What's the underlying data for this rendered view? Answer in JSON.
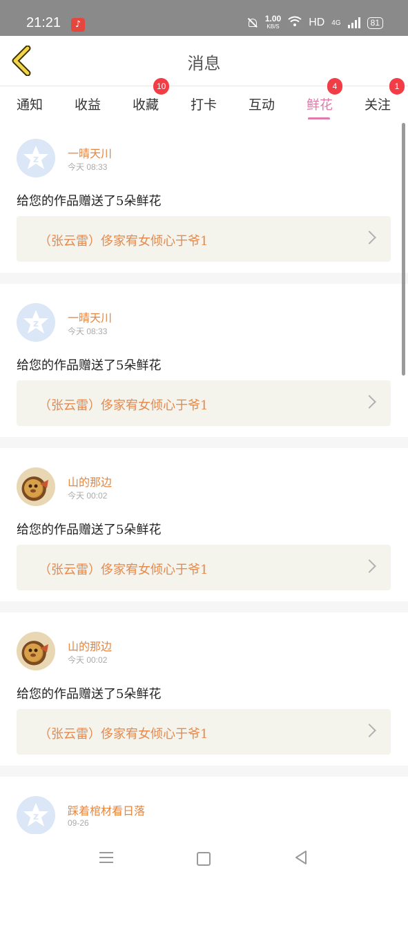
{
  "status_bar": {
    "time": "21:21",
    "app_icon": "music-note-icon",
    "net_speed": "1.00",
    "net_unit": "KB/S",
    "hd": "HD",
    "network": "4G",
    "battery": "81"
  },
  "header": {
    "title": "消息",
    "back_icon": "chevron-left-icon"
  },
  "tabs": [
    {
      "label": "通知",
      "badge": ""
    },
    {
      "label": "收益",
      "badge": ""
    },
    {
      "label": "收藏",
      "badge": "10"
    },
    {
      "label": "打卡",
      "badge": ""
    },
    {
      "label": "互动",
      "badge": ""
    },
    {
      "label": "鲜花",
      "badge": "4",
      "active": true
    },
    {
      "label": "关注",
      "badge": "1"
    }
  ],
  "messages": [
    {
      "name": "一晴天川",
      "time": "今天 08:33",
      "text": "给您的作品赠送了5朵鲜花",
      "work": "（张云雷）侈家宥女倾心于爷1",
      "avatar": "default-avatar"
    },
    {
      "name": "一晴天川",
      "time": "今天 08:33",
      "text": "给您的作品赠送了5朵鲜花",
      "work": "（张云雷）侈家宥女倾心于爷1",
      "avatar": "default-avatar"
    },
    {
      "name": "山的那边",
      "time": "今天 00:02",
      "text": "给您的作品赠送了5朵鲜花",
      "work": "（张云雷）侈家宥女倾心于爷1",
      "avatar": "photo-avatar"
    },
    {
      "name": "山的那边",
      "time": "今天 00:02",
      "text": "给您的作品赠送了5朵鲜花",
      "work": "（张云雷）侈家宥女倾心于爷1",
      "avatar": "photo-avatar"
    },
    {
      "name": "踩着棺材看日落",
      "time": "09-26",
      "text": "",
      "work": "",
      "avatar": "default-avatar"
    }
  ],
  "colors": {
    "accent_pink": "#e07aa8",
    "name_orange": "#e8853d",
    "badge_red": "#f23c46",
    "work_bg": "#f4f3ec"
  }
}
